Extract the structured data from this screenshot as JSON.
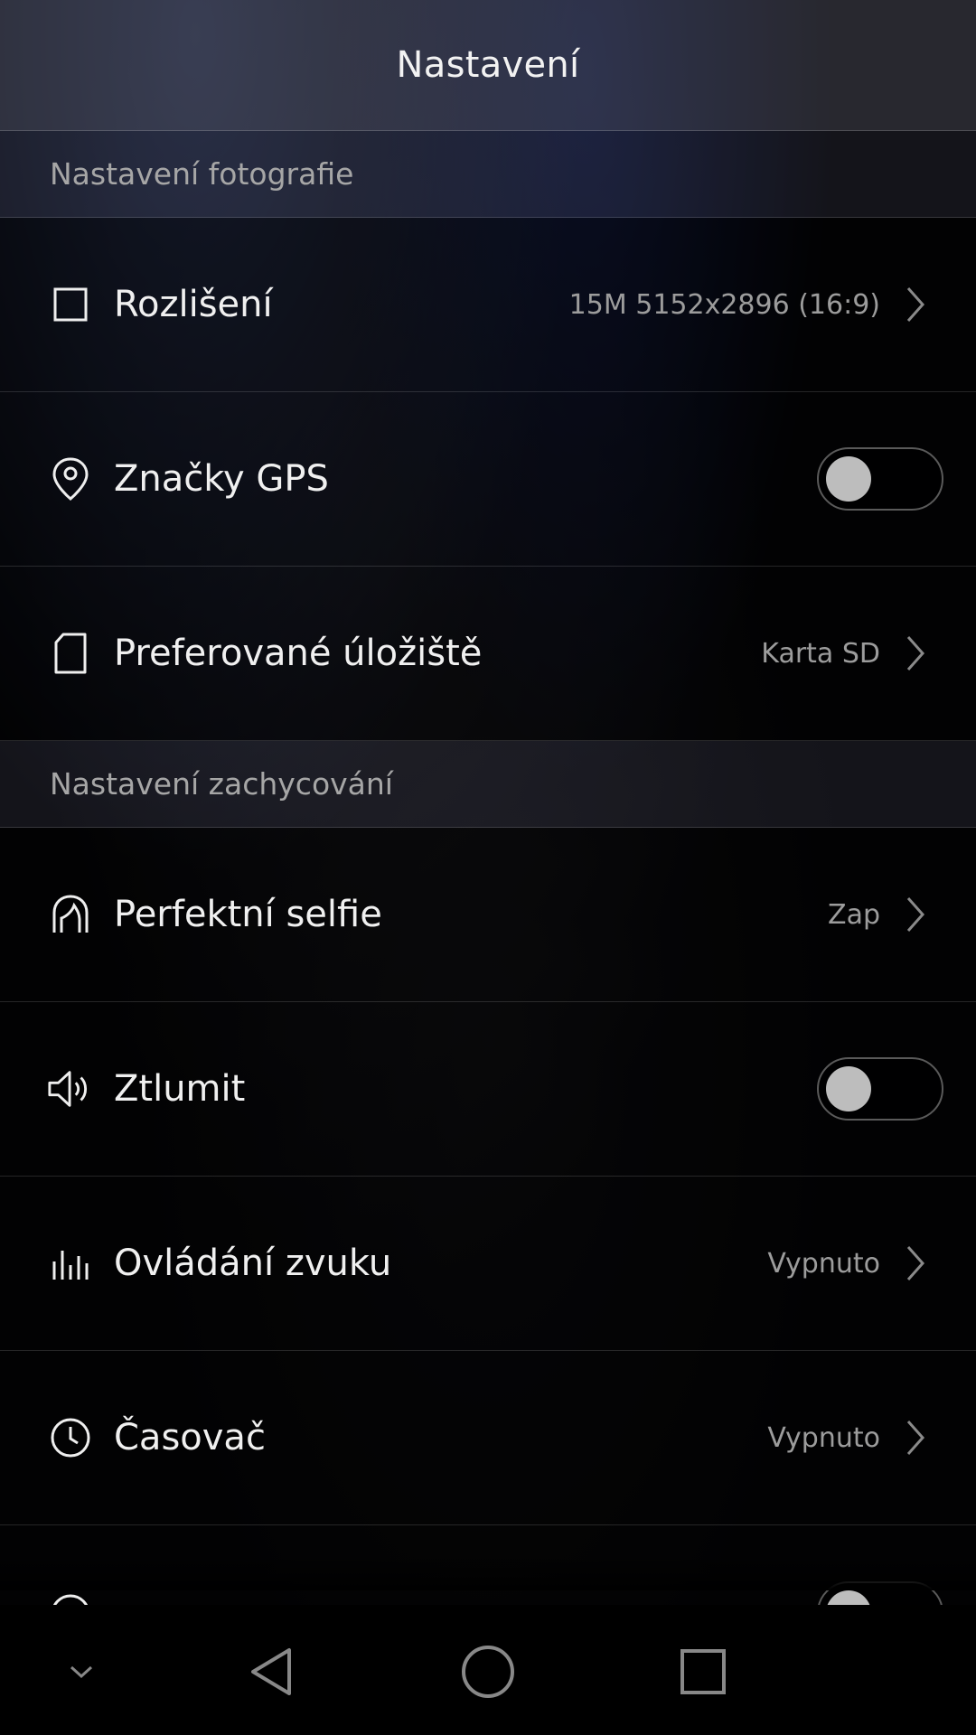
{
  "header": {
    "title": "Nastavení"
  },
  "sections": {
    "photo": "Nastavení fotografie",
    "capture": "Nastavení zachycování"
  },
  "rows": {
    "resolution": {
      "label": "Rozlišení",
      "value": "15M 5152x2896 (16:9)",
      "icon": "square-icon"
    },
    "gps": {
      "label": "Značky GPS",
      "toggle": false,
      "icon": "location-pin-icon"
    },
    "storage": {
      "label": "Preferované úložiště",
      "value": "Karta SD",
      "icon": "sd-card-icon"
    },
    "selfie": {
      "label": "Perfektní selfie",
      "value": "Zap",
      "icon": "selfie-face-icon"
    },
    "mute": {
      "label": "Ztlumit",
      "toggle": false,
      "icon": "speaker-icon"
    },
    "sound_control": {
      "label": "Ovládání zvuku",
      "value": "Vypnuto",
      "icon": "equalizer-icon"
    },
    "timer": {
      "label": "Časovač",
      "value": "Vypnuto",
      "icon": "clock-icon"
    }
  },
  "navbar": {
    "icons": [
      "chevron-down-icon",
      "back-triangle-icon",
      "home-circle-icon",
      "recents-square-icon"
    ]
  },
  "colors": {
    "text": "#f0f0f0",
    "secondary": "#9c9c9c",
    "toggle_knob": "#bdbdbd"
  }
}
